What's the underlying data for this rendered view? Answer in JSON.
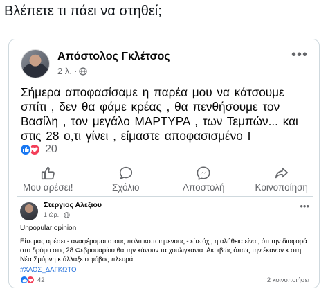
{
  "caption": "Βλέπετε τι πάει να στηθεί;",
  "post": {
    "author": "Απόστολος Γκλέτσος",
    "time": "2 λ.",
    "text": "Σήμερα αποφασίσαμε η παρέα μου να κάτσουμε σπίτι , δεν θα φάμε κρέας , θα πενθήσουμε τον Βασίλη , τον μεγάλο ΜΑΡΤΥΡΑ , των Τεμπών... και στις 28 ο,τι γίνει , είμαστε αποφασισμένο Ι",
    "reaction_count": "20",
    "actions": {
      "like": "Μου αρέσει!",
      "comment": "Σχόλιο",
      "send": "Αποστολή",
      "share": "Κοινοποίηση"
    }
  },
  "inner_post": {
    "author": "Στεργιος Αλεξιου",
    "time": "1 ώρ.",
    "subtitle": "Unpopular opinion",
    "body": "Είτε μας αρέσει - αναφέρομαι στους πολιτικοποιημενους - είτε όχι, η αλήθεια είναι, ότι την διαφορά στο δρόμο στις 28 Φεβρουαρίου θα την κάνουν τα χουλιγκανια. Ακριβώς όπως την έκαναν κ στη Νέα Σμύρνη κ άλλαξε ο φόβος πλευρά.",
    "hashtag": "#ΧΑΟΣ_ΔΑΓΚΩΤΟ",
    "reaction_count": "42",
    "shares": "2 κοινοποιήσει"
  },
  "icons": {
    "globe": "globe-icon",
    "more": "more-horizontal-icon",
    "like": "thumbs-up-icon",
    "comment": "comment-bubble-icon",
    "send": "messenger-send-icon",
    "share": "share-arrow-icon"
  },
  "colors": {
    "like_blue": "#1877f2",
    "love_red": "#f33e58",
    "hashtag_blue": "#216fdb",
    "muted": "#65676b"
  }
}
